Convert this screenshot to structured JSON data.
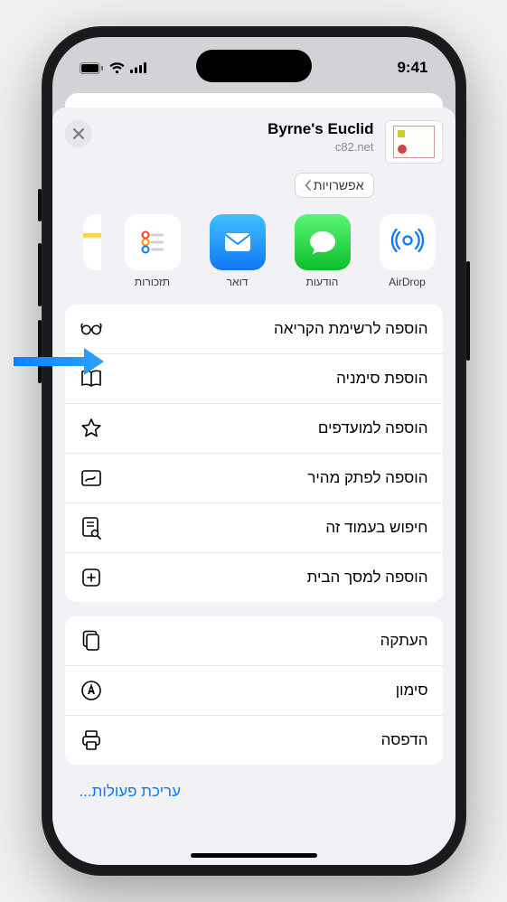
{
  "status": {
    "time": "9:41"
  },
  "header": {
    "title": "Byrne's Euclid",
    "subtitle": "c82.net",
    "options_label": "אפשרויות"
  },
  "apps": {
    "airdrop": "AirDrop",
    "messages": "הודעות",
    "mail": "דואר",
    "reminders": "תזכורות",
    "notes": ""
  },
  "actions": {
    "group1": [
      {
        "label": "הוספה לרשימת הקריאה",
        "icon": "glasses"
      },
      {
        "label": "הוספת סימניה",
        "icon": "book"
      },
      {
        "label": "הוספה למועדפים",
        "icon": "star"
      },
      {
        "label": "הוספה לפתק מהיר",
        "icon": "quicknote"
      },
      {
        "label": "חיפוש בעמוד זה",
        "icon": "findpage"
      },
      {
        "label": "הוספה למסך הבית",
        "icon": "addhome"
      }
    ],
    "group2": [
      {
        "label": "העתקה",
        "icon": "copy"
      },
      {
        "label": "סימון",
        "icon": "markup"
      },
      {
        "label": "הדפסה",
        "icon": "print"
      }
    ]
  },
  "footer": {
    "edit_actions": "עריכת פעולות..."
  }
}
